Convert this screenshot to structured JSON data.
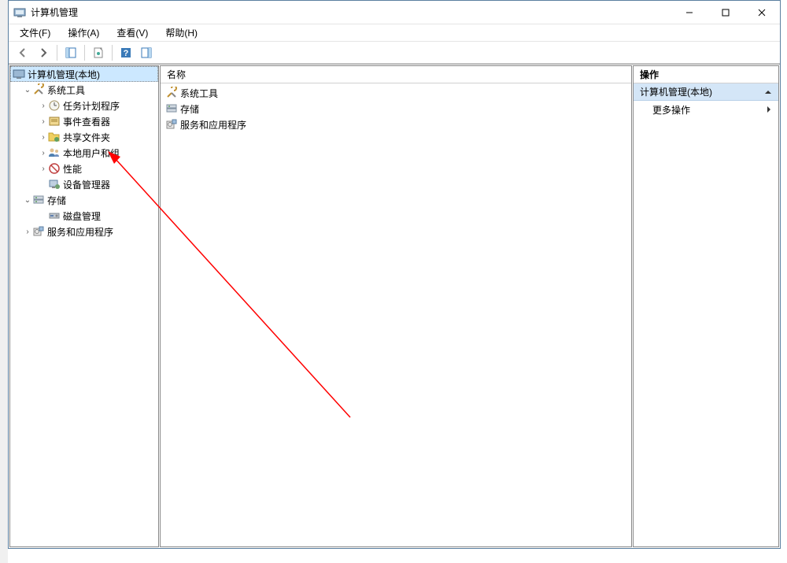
{
  "window": {
    "title": "计算机管理"
  },
  "menubar": {
    "file": "文件(F)",
    "action": "操作(A)",
    "view": "查看(V)",
    "help": "帮助(H)"
  },
  "tree": {
    "root": "计算机管理(本地)",
    "system_tools": "系统工具",
    "task_scheduler": "任务计划程序",
    "event_viewer": "事件查看器",
    "shared_folders": "共享文件夹",
    "local_users_groups": "本地用户和组",
    "performance": "性能",
    "device_manager": "设备管理器",
    "storage": "存储",
    "disk_management": "磁盘管理",
    "services_apps": "服务和应用程序"
  },
  "list": {
    "header_name": "名称",
    "items": {
      "system_tools": "系统工具",
      "storage": "存储",
      "services_apps": "服务和应用程序"
    }
  },
  "actions": {
    "header": "操作",
    "section": "计算机管理(本地)",
    "more": "更多操作"
  }
}
